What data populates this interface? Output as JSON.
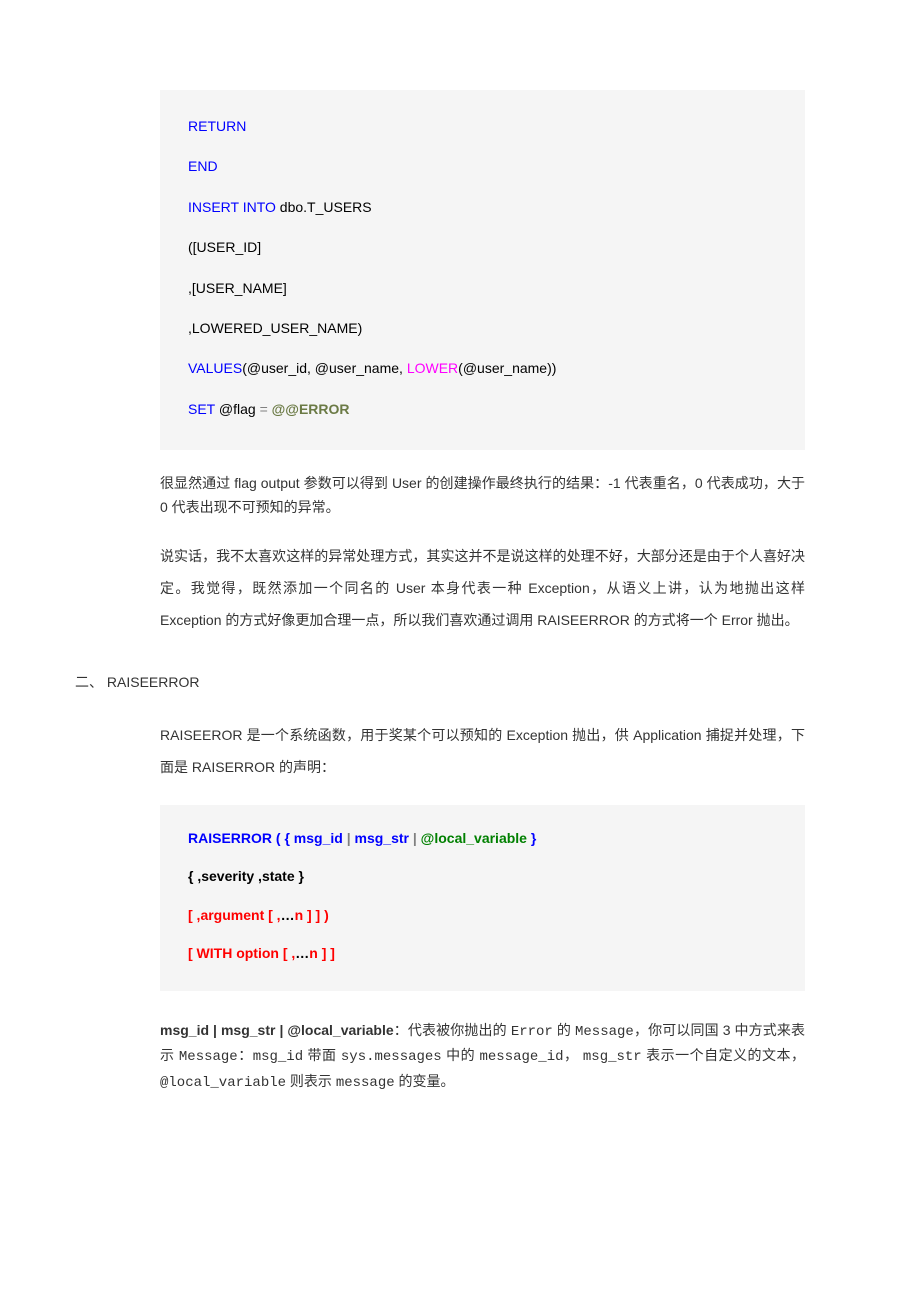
{
  "code1": {
    "l1": "RETURN",
    "l2": "END",
    "l3a": "INSERT INTO",
    "l3b": " dbo.T_USERS",
    "l4": "([USER_ID]",
    "l5": ",[USER_NAME]",
    "l6": ",LOWERED_USER_NAME)",
    "l7a": "VALUES",
    "l7b": "(@user_id, @user_name, ",
    "l7c": "LOWER",
    "l7d": "(@user_name))",
    "l8a": "SET",
    "l8b": " @flag ",
    "l8c": "=",
    "l8d": " ",
    "l8e": "@@ERROR"
  },
  "para1": "很显然通过 flag output 参数可以得到 User 的创建操作最终执行的结果：-1 代表重名，0 代表成功，大于 0 代表出现不可预知的异常。",
  "para2": "说实话，我不太喜欢这样的异常处理方式，其实这并不是说这样的处理不好，大部分还是由于个人喜好决定。我觉得，既然添加一个同名的 User 本身代表一种 Exception，从语义上讲，认为地抛出这样 Exception 的方式好像更加合理一点，所以我们喜欢通过调用 RAISEERROR 的方式将一个 Error 抛出。",
  "heading": "二、 RAISEERROR",
  "para3": "RAISEEROR 是一个系统函数，用于奖某个可以预知的 Exception 抛出，供 Application 捕捉并处理，下面是 RAISERROR 的声明：",
  "code2": {
    "l1a": "RAISERROR ( { msg_id ",
    "l1b": "|",
    "l1c": " msg_str ",
    "l1d": "|",
    "l1e": " @local_variable ",
    "l1f": "}",
    "l2": "{ ,severity ,state }",
    "l3a": "[ ,argument [ ,",
    "l3b": "…",
    "l3c": "n ] ] )",
    "l4a": "[ WITH option [ ,",
    "l4b": "…",
    "l4c": "n ] ]"
  },
  "explain": {
    "prefix": "msg_id | msg_str | @local_variable",
    "t1": "：代表被你抛出的 ",
    "m1": "Error",
    "t2": " 的 ",
    "m2": "Message",
    "t3": "，你可以同国 3 中方式来表示 ",
    "m3": "Message",
    "t4": "：",
    "m4": "msg_id",
    "t5": " 带面 ",
    "m5": "sys.messages",
    "t6": " 中的 ",
    "m6": "message_id",
    "t7": "， ",
    "m7": "msg_str",
    "t8": " 表示一个自定义的文本，",
    "m8": "@local_variable",
    "t9": " 则表示 ",
    "m9": "message",
    "t10": " 的变量。"
  }
}
